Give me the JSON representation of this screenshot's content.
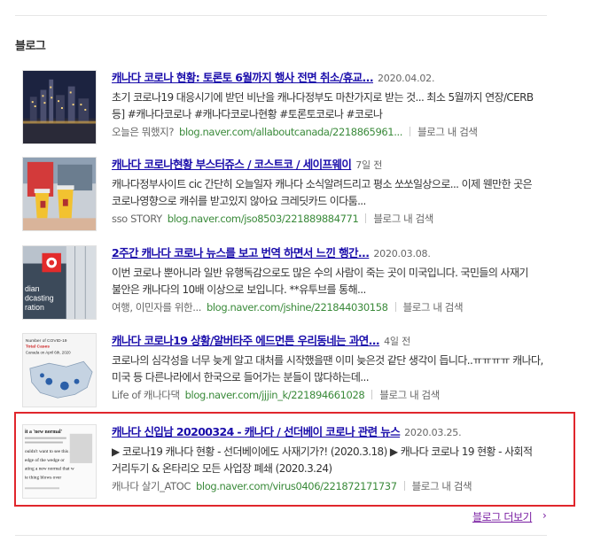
{
  "section": {
    "title": "블로그"
  },
  "items": [
    {
      "title": "캐나다 코로나 현황: 토론토 6월까지 행사 전면 취소/휴교...",
      "date": "2020.04.02.",
      "desc": "초기 코로나19 대응시기에 받던 비난을 캐나다정부도 마찬가지로 받는 것... 최소 5월까지 연장/CERB 등] #캐나다코로나 #캐나다코로나현황 #토론토코로나 #코로나",
      "author": "오늘은 뭐했지?",
      "url": "blog.naver.com/allaboutcanada/2218865961...",
      "bloglink": "블로그 내 검색"
    },
    {
      "title": "캐나다 코로나현황 부스터쥬스 / 코스트코 / 세이프웨이",
      "date": "7일 전",
      "desc": "캐나다정부사이트 cic 간단히 오늘일자 캐나다 소식알려드리고 평소 쏘쏘일상으로... 이제 웬만한 곳은 코로나영향으로 캐쉬를 받고있지 않아요 크레딧카드 이다툼...",
      "author": "sso STORY",
      "url": "blog.naver.com/jso8503/221889884771",
      "bloglink": "블로그 내 검색"
    },
    {
      "title": "2주간 캐나다 코로나 뉴스를 보고 번역 하면서 느낀 행간...",
      "date": "2020.03.08.",
      "desc": "이번 코로나 뿐아니라 일반 유행독감으로도 많은 수의 사람이 죽는 곳이 미국입니다. 국민들의 사재기 불안은 캐나다의 10배 이상으로 보입니다. **유투브를 통해...",
      "author": "여행, 이민자를 위한...",
      "url": "blog.naver.com/jshine/221844030158",
      "bloglink": "블로그 내 검색"
    },
    {
      "title": "캐나다 코로나19 상황/알버타주 에드먼튼 우리동네는 과연...",
      "date": "4일 전",
      "desc": "코로나의 심각성을 너무 늦게 알고 대처를 시작했을땐 이미 늦은것 같단 생각이 듭니다..ㅠㅠㅠㅠ 캐나다, 미국 등 다른나라에서 한국으로 들어가는 분들이 많다하는데...",
      "author": "Life of 캐나다댁",
      "url": "blog.naver.com/jjjin_k/221894661028",
      "bloglink": "블로그 내 검색"
    },
    {
      "title": "캐나다 신입남 20200324 - 캐나다 / 선더베이 코로나 관련 뉴스",
      "date": "2020.03.25.",
      "desc": "▶ 코로나19 캐나다 현황 - 선더베이에도 사재기가?! (2020.3.18) ▶ 캐나다 코로나 19 현황 - 사회적 거리두기 & 온타리오 모든 사업장 폐쇄 (2020.3.24)",
      "author": "캐나다 살기_ATOC",
      "url": "blog.naver.com/virus0406/221872171737",
      "bloglink": "블로그 내 검색"
    }
  ],
  "more": {
    "label": "블로그 더보기",
    "arrow": "›"
  },
  "thumb_texts": {
    "t4_line1": "Number of COVID-19",
    "t4_line2": "Total Cases",
    "t4_line3": "Canada on April 6th, 2020",
    "t3_line1": "dian",
    "t3_line2": "dcasting",
    "t3_line3": "ration",
    "t5_line1": "it a 'new normal'",
    "t5_line2": "ouldn't want to see this as th",
    "t5_line3": "edge of the wedge or",
    "t5_line4": "ating a new normal that w",
    "t5_line5": "ie thing blows over"
  },
  "colors": {
    "title": "#1a0dab",
    "url": "#3a8a3a",
    "highlight": "#e0262c",
    "more": "#7a1fa2"
  }
}
